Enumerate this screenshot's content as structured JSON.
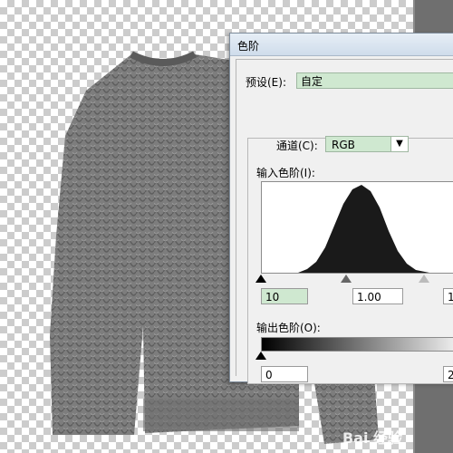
{
  "dialog": {
    "title": "色阶",
    "preset_label": "预设(E):",
    "preset_value": "自定",
    "channel_label": "通道(C):",
    "channel_value": "RGB",
    "input_levels_label": "输入色阶(I):",
    "input_black": "10",
    "input_gamma": "1.00",
    "input_white": "1",
    "output_levels_label": "输出色阶(O):",
    "output_black": "0",
    "output_white": "2"
  },
  "watermark": {
    "text": "Bai 经验"
  },
  "icons": {
    "channel_dropdown": "chevron-down-icon",
    "black_point": "triangle-up-icon",
    "gamma_point": "triangle-up-icon",
    "white_point": "triangle-up-icon"
  },
  "colors": {
    "field_highlight": "#cfe8d0",
    "histogram_fill": "#1a1a1a",
    "sweater": "#7a7a7a"
  }
}
